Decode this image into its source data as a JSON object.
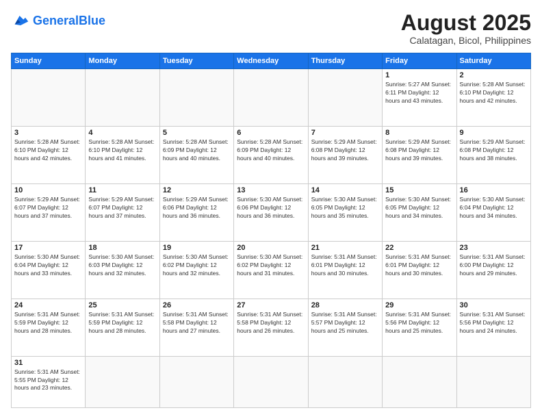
{
  "header": {
    "logo_general": "General",
    "logo_blue": "Blue",
    "month_year": "August 2025",
    "location": "Calatagan, Bicol, Philippines"
  },
  "weekdays": [
    "Sunday",
    "Monday",
    "Tuesday",
    "Wednesday",
    "Thursday",
    "Friday",
    "Saturday"
  ],
  "weeks": [
    [
      {
        "day": "",
        "info": ""
      },
      {
        "day": "",
        "info": ""
      },
      {
        "day": "",
        "info": ""
      },
      {
        "day": "",
        "info": ""
      },
      {
        "day": "",
        "info": ""
      },
      {
        "day": "1",
        "info": "Sunrise: 5:27 AM\nSunset: 6:11 PM\nDaylight: 12 hours and 43 minutes."
      },
      {
        "day": "2",
        "info": "Sunrise: 5:28 AM\nSunset: 6:10 PM\nDaylight: 12 hours and 42 minutes."
      }
    ],
    [
      {
        "day": "3",
        "info": "Sunrise: 5:28 AM\nSunset: 6:10 PM\nDaylight: 12 hours and 42 minutes."
      },
      {
        "day": "4",
        "info": "Sunrise: 5:28 AM\nSunset: 6:10 PM\nDaylight: 12 hours and 41 minutes."
      },
      {
        "day": "5",
        "info": "Sunrise: 5:28 AM\nSunset: 6:09 PM\nDaylight: 12 hours and 40 minutes."
      },
      {
        "day": "6",
        "info": "Sunrise: 5:28 AM\nSunset: 6:09 PM\nDaylight: 12 hours and 40 minutes."
      },
      {
        "day": "7",
        "info": "Sunrise: 5:29 AM\nSunset: 6:08 PM\nDaylight: 12 hours and 39 minutes."
      },
      {
        "day": "8",
        "info": "Sunrise: 5:29 AM\nSunset: 6:08 PM\nDaylight: 12 hours and 39 minutes."
      },
      {
        "day": "9",
        "info": "Sunrise: 5:29 AM\nSunset: 6:08 PM\nDaylight: 12 hours and 38 minutes."
      }
    ],
    [
      {
        "day": "10",
        "info": "Sunrise: 5:29 AM\nSunset: 6:07 PM\nDaylight: 12 hours and 37 minutes."
      },
      {
        "day": "11",
        "info": "Sunrise: 5:29 AM\nSunset: 6:07 PM\nDaylight: 12 hours and 37 minutes."
      },
      {
        "day": "12",
        "info": "Sunrise: 5:29 AM\nSunset: 6:06 PM\nDaylight: 12 hours and 36 minutes."
      },
      {
        "day": "13",
        "info": "Sunrise: 5:30 AM\nSunset: 6:06 PM\nDaylight: 12 hours and 36 minutes."
      },
      {
        "day": "14",
        "info": "Sunrise: 5:30 AM\nSunset: 6:05 PM\nDaylight: 12 hours and 35 minutes."
      },
      {
        "day": "15",
        "info": "Sunrise: 5:30 AM\nSunset: 6:05 PM\nDaylight: 12 hours and 34 minutes."
      },
      {
        "day": "16",
        "info": "Sunrise: 5:30 AM\nSunset: 6:04 PM\nDaylight: 12 hours and 34 minutes."
      }
    ],
    [
      {
        "day": "17",
        "info": "Sunrise: 5:30 AM\nSunset: 6:04 PM\nDaylight: 12 hours and 33 minutes."
      },
      {
        "day": "18",
        "info": "Sunrise: 5:30 AM\nSunset: 6:03 PM\nDaylight: 12 hours and 32 minutes."
      },
      {
        "day": "19",
        "info": "Sunrise: 5:30 AM\nSunset: 6:02 PM\nDaylight: 12 hours and 32 minutes."
      },
      {
        "day": "20",
        "info": "Sunrise: 5:30 AM\nSunset: 6:02 PM\nDaylight: 12 hours and 31 minutes."
      },
      {
        "day": "21",
        "info": "Sunrise: 5:31 AM\nSunset: 6:01 PM\nDaylight: 12 hours and 30 minutes."
      },
      {
        "day": "22",
        "info": "Sunrise: 5:31 AM\nSunset: 6:01 PM\nDaylight: 12 hours and 30 minutes."
      },
      {
        "day": "23",
        "info": "Sunrise: 5:31 AM\nSunset: 6:00 PM\nDaylight: 12 hours and 29 minutes."
      }
    ],
    [
      {
        "day": "24",
        "info": "Sunrise: 5:31 AM\nSunset: 5:59 PM\nDaylight: 12 hours and 28 minutes."
      },
      {
        "day": "25",
        "info": "Sunrise: 5:31 AM\nSunset: 5:59 PM\nDaylight: 12 hours and 28 minutes."
      },
      {
        "day": "26",
        "info": "Sunrise: 5:31 AM\nSunset: 5:58 PM\nDaylight: 12 hours and 27 minutes."
      },
      {
        "day": "27",
        "info": "Sunrise: 5:31 AM\nSunset: 5:58 PM\nDaylight: 12 hours and 26 minutes."
      },
      {
        "day": "28",
        "info": "Sunrise: 5:31 AM\nSunset: 5:57 PM\nDaylight: 12 hours and 25 minutes."
      },
      {
        "day": "29",
        "info": "Sunrise: 5:31 AM\nSunset: 5:56 PM\nDaylight: 12 hours and 25 minutes."
      },
      {
        "day": "30",
        "info": "Sunrise: 5:31 AM\nSunset: 5:56 PM\nDaylight: 12 hours and 24 minutes."
      }
    ],
    [
      {
        "day": "31",
        "info": "Sunrise: 5:31 AM\nSunset: 5:55 PM\nDaylight: 12 hours and 23 minutes."
      },
      {
        "day": "",
        "info": ""
      },
      {
        "day": "",
        "info": ""
      },
      {
        "day": "",
        "info": ""
      },
      {
        "day": "",
        "info": ""
      },
      {
        "day": "",
        "info": ""
      },
      {
        "day": "",
        "info": ""
      }
    ]
  ]
}
